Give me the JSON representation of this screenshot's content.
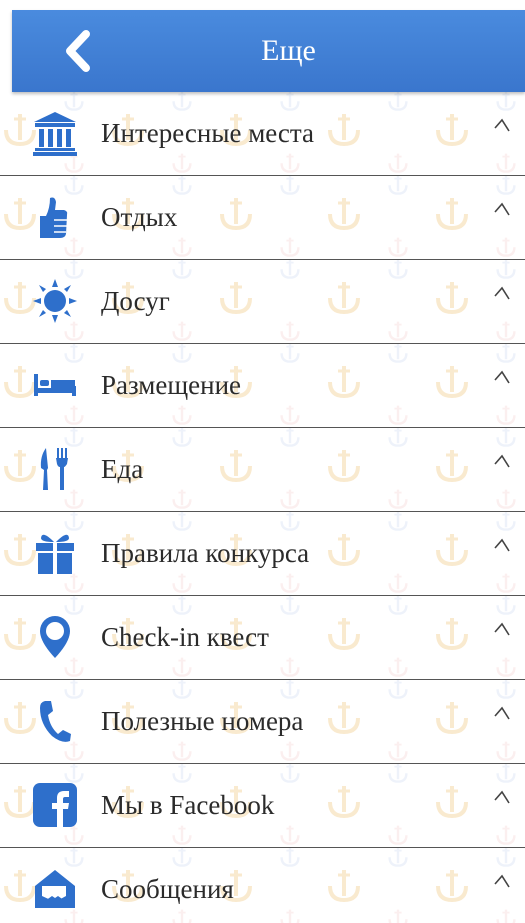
{
  "header": {
    "title": "Еще",
    "back_icon": "chevron-left-icon"
  },
  "colors": {
    "header_bg": "#3f80d3",
    "icon_blue": "#2e6fcb",
    "text": "#2b2b2b",
    "divider": "#555555"
  },
  "menu": {
    "items": [
      {
        "label": "Интересные места",
        "icon": "museum-icon"
      },
      {
        "label": "Отдых",
        "icon": "thumbs-up-icon"
      },
      {
        "label": "Досуг",
        "icon": "sun-icon"
      },
      {
        "label": "Размещение",
        "icon": "bed-icon"
      },
      {
        "label": "Еда",
        "icon": "fork-knife-icon"
      },
      {
        "label": "Правила конкурса",
        "icon": "gift-icon"
      },
      {
        "label": "Check-in квест",
        "icon": "map-pin-icon"
      },
      {
        "label": "Полезные номера",
        "icon": "phone-icon"
      },
      {
        "label": "Мы в Facebook",
        "icon": "facebook-icon"
      },
      {
        "label": "Сообщения",
        "icon": "envelope-icon"
      }
    ]
  }
}
